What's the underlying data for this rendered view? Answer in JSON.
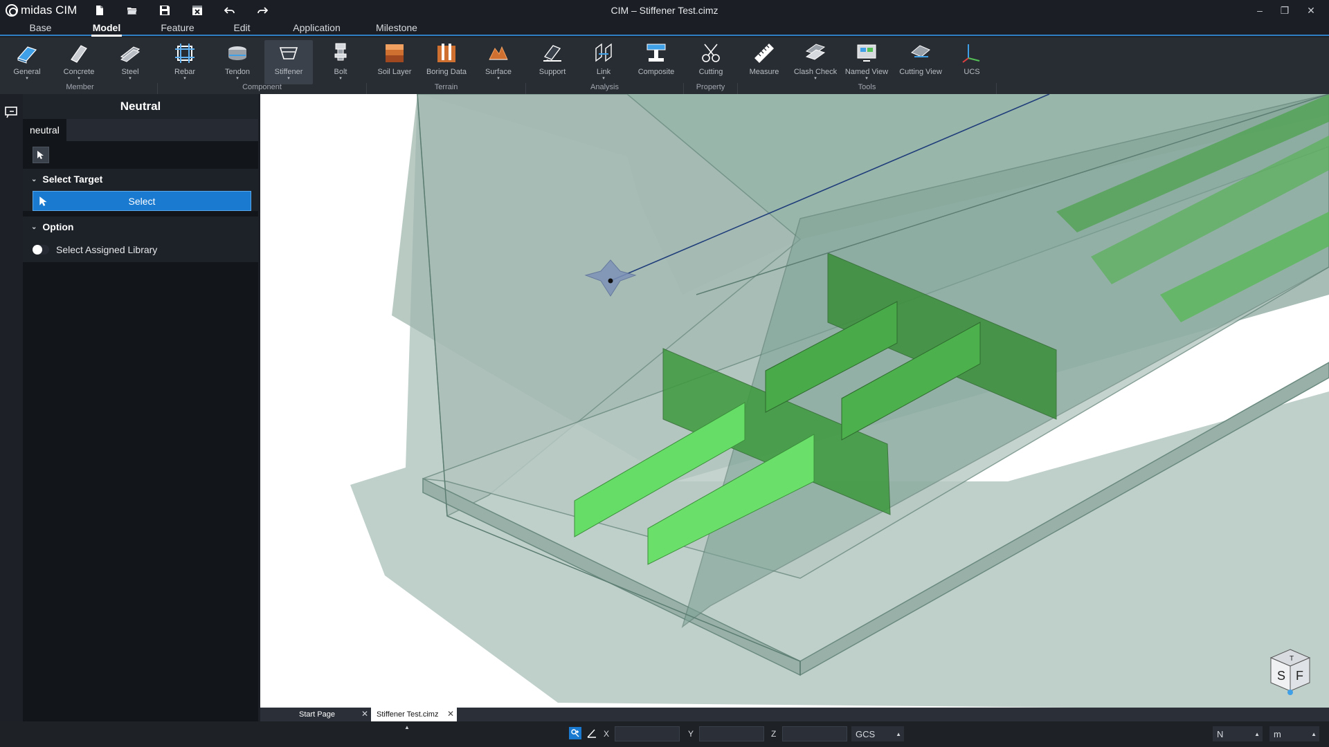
{
  "app": {
    "logo_text": "midas CIM",
    "window_title": "CIM – Stiffener Test.cimz"
  },
  "quick_access": [
    "new-file-icon",
    "open-folder-icon",
    "save-icon",
    "close-file-icon",
    "undo-icon",
    "redo-icon"
  ],
  "window_controls": {
    "minimize": "–",
    "restore": "❐",
    "close": "✕"
  },
  "menu": {
    "tabs": [
      "Base",
      "Model",
      "Feature",
      "Edit",
      "Application",
      "Milestone"
    ],
    "active": "Model"
  },
  "ribbon": {
    "buttons": [
      {
        "label": "General"
      },
      {
        "label": "Concrete"
      },
      {
        "label": "Steel"
      },
      {
        "label": "Rebar"
      },
      {
        "label": "Tendon"
      },
      {
        "label": "Stiffener"
      },
      {
        "label": "Bolt"
      },
      {
        "label": "Soil Layer"
      },
      {
        "label": "Boring Data"
      },
      {
        "label": "Surface"
      },
      {
        "label": "Support"
      },
      {
        "label": "Link"
      },
      {
        "label": "Composite"
      },
      {
        "label": "Cutting"
      },
      {
        "label": "Measure"
      },
      {
        "label": "Clash Check"
      },
      {
        "label": "Named View"
      },
      {
        "label": "Cutting View"
      },
      {
        "label": "UCS"
      }
    ],
    "groups": [
      "Member",
      "Component",
      "Terrain",
      "Analysis",
      "Property",
      "Tools"
    ],
    "active": "Stiffener"
  },
  "panel": {
    "title": "Neutral",
    "tab": "neutral",
    "select_target": {
      "header": "Select Target",
      "button": "Select"
    },
    "option": {
      "header": "Option",
      "toggle_label": "Select Assigned Library",
      "toggle_on": false
    }
  },
  "doc_tabs": [
    {
      "label": "Start Page",
      "active": false
    },
    {
      "label": "Stiffener Test.cimz",
      "active": true
    }
  ],
  "view_cube": {
    "labels": [
      "T",
      "S",
      "F"
    ]
  },
  "status": {
    "coord_labels": [
      "X",
      "Y",
      "Z"
    ],
    "coord_values": [
      "",
      "",
      ""
    ],
    "coord_system": "GCS",
    "force_unit": "N",
    "length_unit": "m"
  },
  "colors": {
    "accent": "#1a7ad0",
    "stiffener_green": "#55d255",
    "girder_gray": "#6f8f86"
  }
}
